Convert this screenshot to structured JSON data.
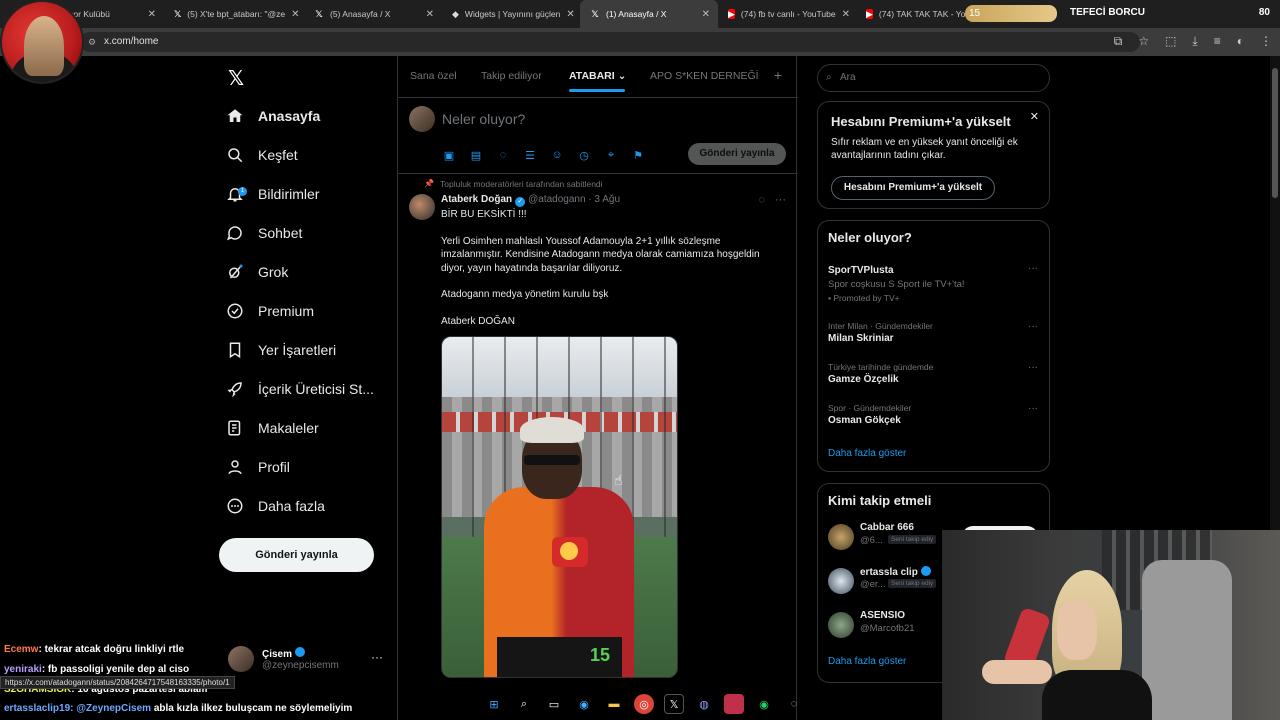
{
  "browser": {
    "tabs": [
      {
        "label": "rbirliği Spor Kulübü",
        "icon": "x"
      },
      {
        "label": "(5) X'te bpt_atabarı: \"@ze",
        "icon": "x"
      },
      {
        "label": "(5) Anasayfa / X",
        "icon": "x"
      },
      {
        "label": "Widgets | Yayınını güçlen",
        "icon": "shield"
      },
      {
        "label": "(1) Anasayfa / X",
        "icon": "x",
        "active": true
      },
      {
        "label": "(74) fb tv canlı - YouTube",
        "icon": "youtube"
      },
      {
        "label": "(74) TAK TAK TAK - YouT",
        "icon": "youtube"
      }
    ],
    "address": "x.com/home",
    "overlay_progress": "15",
    "overlay_title": "TEFECİ BORCU",
    "overlay_value": "80"
  },
  "x": {
    "logo": "𝕏",
    "nav": [
      {
        "label": "Anasayfa",
        "icon": "home-icon",
        "bold": true
      },
      {
        "label": "Keşfet",
        "icon": "search-icon"
      },
      {
        "label": "Bildirimler",
        "icon": "bell-icon",
        "badge": "1"
      },
      {
        "label": "Sohbet",
        "icon": "chat-icon"
      },
      {
        "label": "Grok",
        "icon": "grok-icon"
      },
      {
        "label": "Premium",
        "icon": "premium-icon"
      },
      {
        "label": "Yer İşaretleri",
        "icon": "bookmark-icon"
      },
      {
        "label": "İçerik Üreticisi St...",
        "icon": "rocket-icon"
      },
      {
        "label": "Makaleler",
        "icon": "article-icon"
      },
      {
        "label": "Profil",
        "icon": "profile-icon"
      },
      {
        "label": "Daha fazla",
        "icon": "more-icon"
      }
    ],
    "post_button": "Gönderi yayınla",
    "profile": {
      "name": "Çisem",
      "handle": "@zeynepcisemm"
    },
    "feed_tabs": [
      "Sana özel",
      "Takip ediliyor",
      "ATABARI",
      "APO S*KEN DERNEĞİ"
    ],
    "active_tab": "ATABARI",
    "compose": {
      "placeholder": "Neler oluyor?",
      "button": "Gönderi yayınla"
    },
    "tweet": {
      "pinned": "Topluluk moderatörleri tarafından sabitlendi",
      "name": "Ataberk Doğan",
      "handle": "@atadogann",
      "date": "· 3 Ağu",
      "paragraphs": [
        "BİR BU EKSİKTİ !!!",
        "Yerli Osimhen mahlaslı Youssof Adamouyla 2+1 yıllık sözleşme imzalanmıştır. Kendisine Atadogann medya olarak camiamıza hoşgeldin diyor, yayın hayatında başarılar diliyoruz.",
        "Atadogann medya yönetim kurulu bşk",
        "Ataberk DOĞAN"
      ],
      "media_number": "15"
    },
    "search_placeholder": "Ara",
    "premium": {
      "title": "Hesabını Premium+'a yükselt",
      "desc": "Sıfır reklam ve en yüksek yanıt önceliği ek avantajlarının tadını çıkar.",
      "button": "Hesabını Premium+'a yükselt"
    },
    "trends": {
      "title": "Neler oluyor?",
      "items": [
        {
          "context": "",
          "name": "SporTVPlusta",
          "sub": "Spor coşkusu S Sport ile TV+'ta!",
          "promo": "Promoted by TV+"
        },
        {
          "context": "Inter Milan · Gündemdekiler",
          "name": "Milan Skriniar"
        },
        {
          "context": "Türkiye tarihinde gündemde",
          "name": "Gamze Özçelik"
        },
        {
          "context": "Spor · Gündemdekiler",
          "name": "Osman Gökçek"
        }
      ],
      "more": "Daha fazla göster"
    },
    "who_to_follow": {
      "title": "Kimi takip etmeli",
      "items": [
        {
          "name": "Cabbar 666",
          "handle": "@6...",
          "tag": "Seni takip ediy"
        },
        {
          "name": "ertassla clip",
          "handle": "@er...",
          "tag": "Seni takip ediy"
        },
        {
          "name": "ASENSIO",
          "handle": "@Marcofb21"
        }
      ],
      "more": "Daha fazla göster"
    }
  },
  "stream": {
    "chat": [
      {
        "user": "Ecemw",
        "msg": ": tekrar atcak doğru linkliyi rtle"
      },
      {
        "user": "yeniraki",
        "msg": ": fb passoligi yenile dep al ciso"
      },
      {
        "user": "S2GHAMSIGK",
        "msg": ": 16 ağustos pazartesi ablam"
      },
      {
        "user": "ertasslaclip19",
        "mention": ": @ZeynepCisem",
        "msg": " abla kızla ilkez buluşcam ne söylemeliyim"
      }
    ],
    "url_tooltip": "https://x.com/atadogann/status/2084264717548163335/photo/1"
  }
}
